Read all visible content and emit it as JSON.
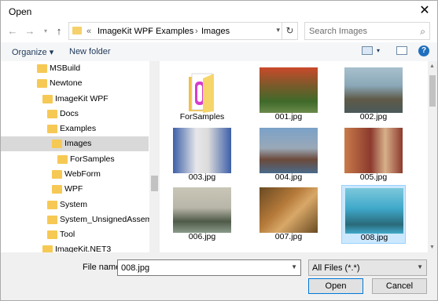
{
  "window": {
    "title": "Open"
  },
  "nav": {
    "path": [
      "ImageKit WPF",
      "Examples",
      "Images"
    ],
    "chevron": "«",
    "search_placeholder": "Search Images"
  },
  "toolbar": {
    "organize": "Organize ▾",
    "new_folder": "New folder"
  },
  "tree": [
    {
      "label": "MSBuild"
    },
    {
      "label": "Newtone"
    },
    {
      "label": "ImageKit WPF"
    },
    {
      "label": "Docs"
    },
    {
      "label": "Examples"
    },
    {
      "label": "Images",
      "selected": true
    },
    {
      "label": "ForSamples"
    },
    {
      "label": "WebForm"
    },
    {
      "label": "WPF"
    },
    {
      "label": "System"
    },
    {
      "label": "System_UnsignedAssembly"
    },
    {
      "label": "Tool"
    },
    {
      "label": "ImageKit.NET3"
    }
  ],
  "files": [
    {
      "name": "ForSamples",
      "kind": "folder"
    },
    {
      "name": "001.jpg",
      "kind": "image",
      "colors": [
        "#3f6a2a",
        "#c9492a"
      ]
    },
    {
      "name": "002.jpg",
      "kind": "image",
      "colors": [
        "#8aa8b8",
        "#5f5a48"
      ]
    },
    {
      "name": "003.jpg",
      "kind": "image",
      "colors": [
        "#3d5fa8",
        "#e7e7ea"
      ]
    },
    {
      "name": "004.jpg",
      "kind": "image",
      "colors": [
        "#7aa2c8",
        "#6b4a3a"
      ]
    },
    {
      "name": "005.jpg",
      "kind": "image",
      "colors": [
        "#c97b4a",
        "#8c3a2e"
      ]
    },
    {
      "name": "006.jpg",
      "kind": "image",
      "colors": [
        "#c9c6b8",
        "#4f5a48"
      ]
    },
    {
      "name": "007.jpg",
      "kind": "image",
      "colors": [
        "#b57a3a",
        "#6a4a22"
      ]
    },
    {
      "name": "008.jpg",
      "kind": "image",
      "colors": [
        "#3fa8c9",
        "#2a6a7a"
      ],
      "selected": true
    }
  ],
  "bottom": {
    "file_name_label": "File name:",
    "file_name_value": "008.jpg",
    "file_type": "All Files (*.*)",
    "open": "Open",
    "cancel": "Cancel"
  }
}
